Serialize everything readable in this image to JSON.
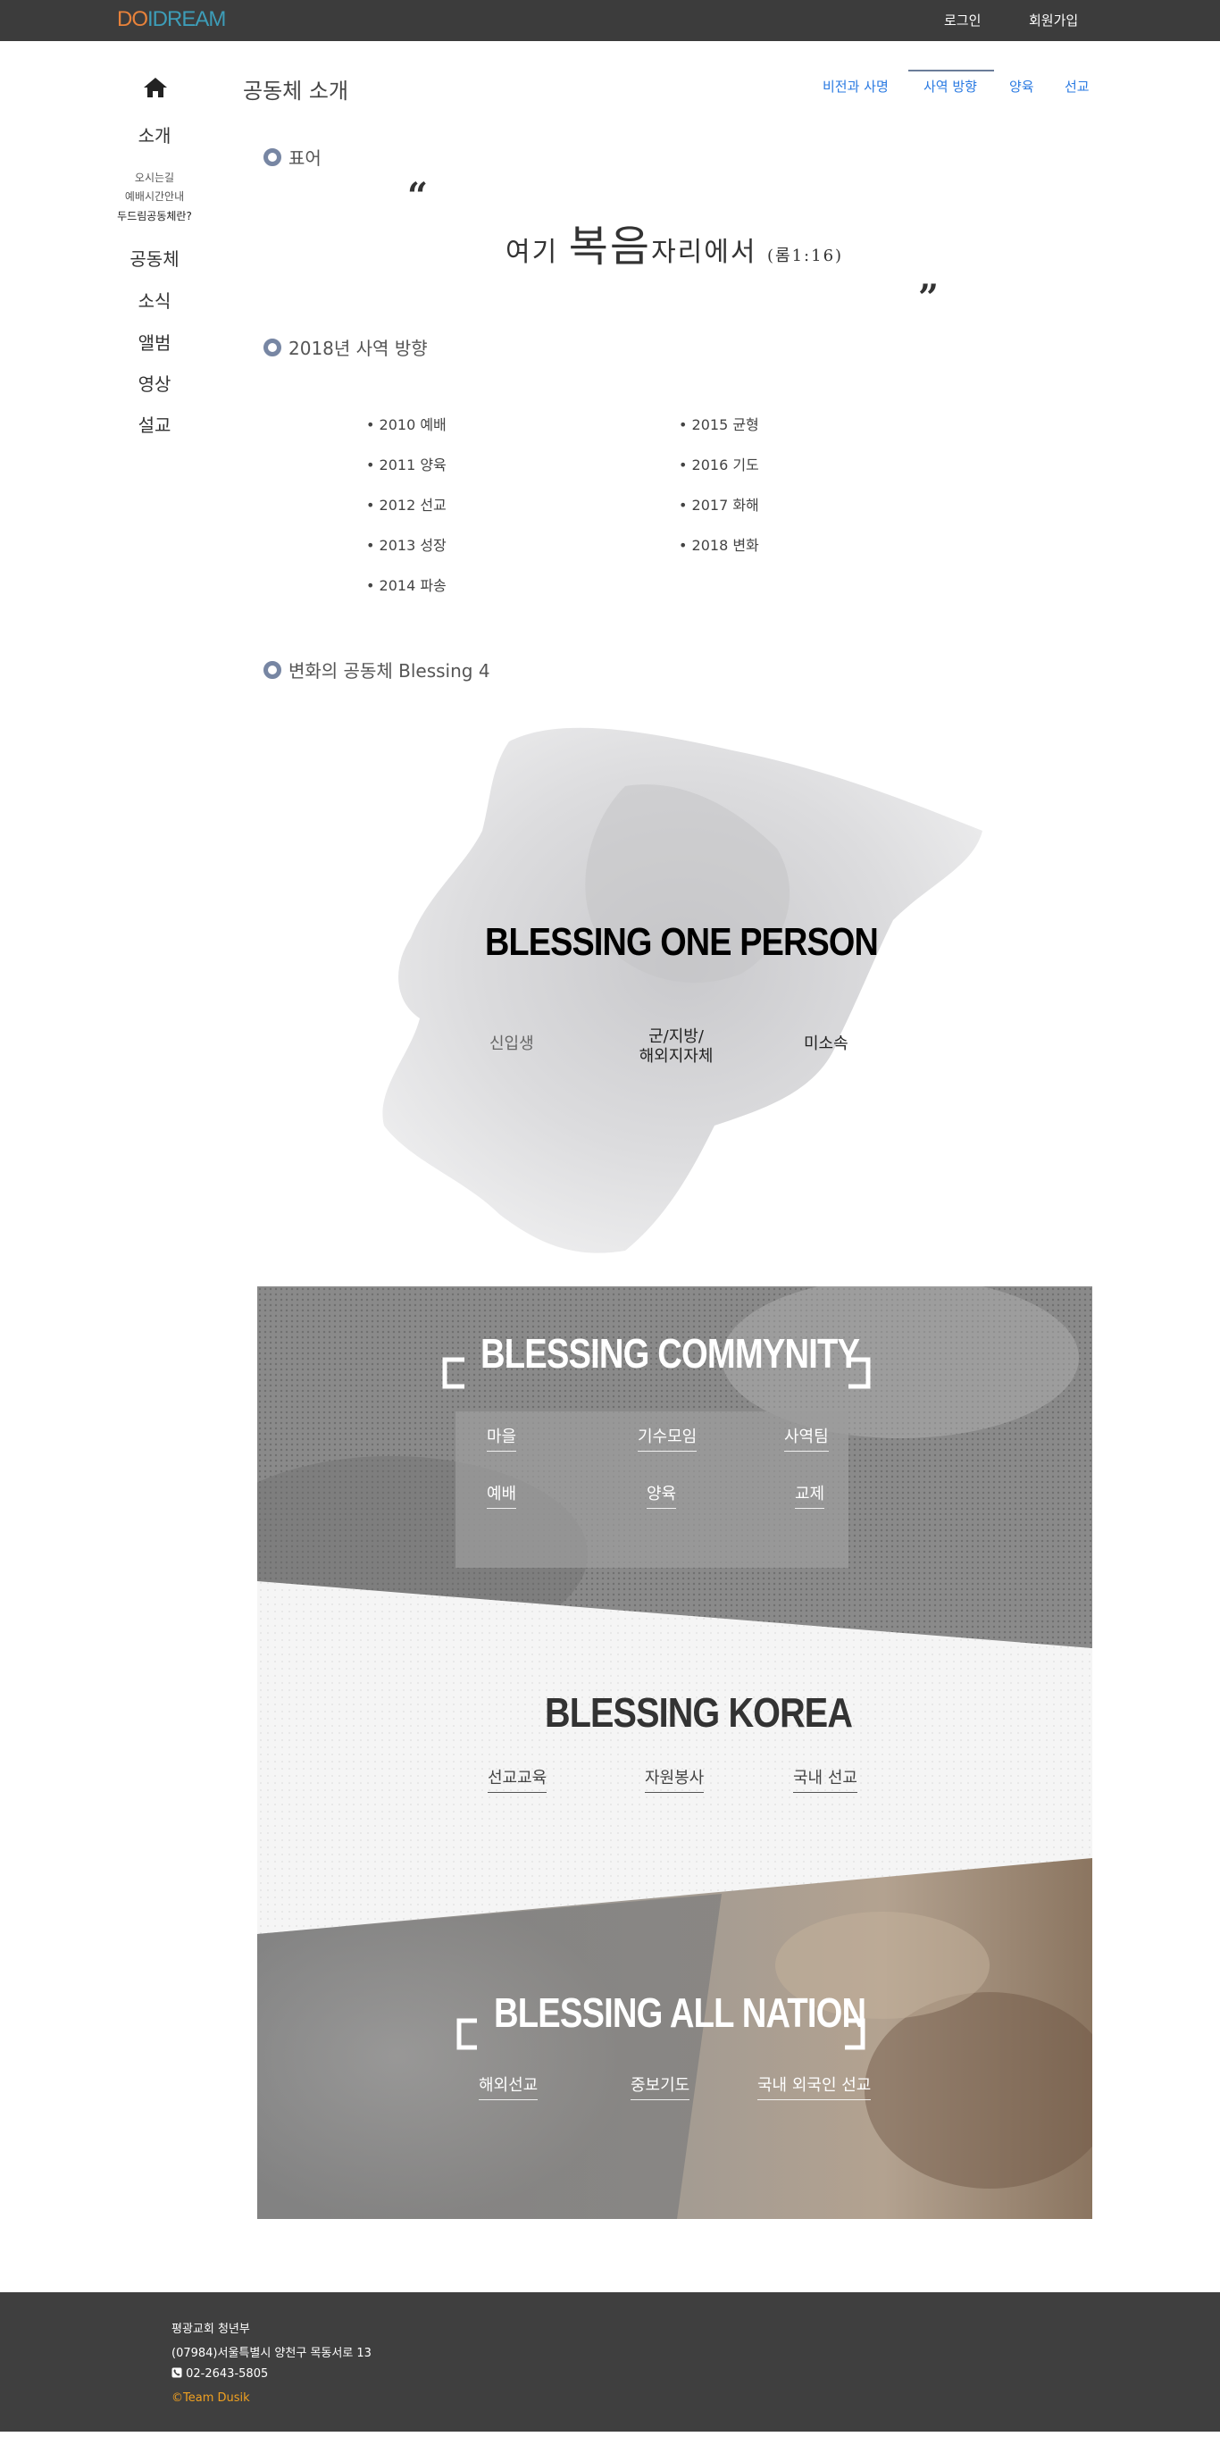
{
  "header": {
    "logo": {
      "part1": "DO",
      "part2": "I",
      "part3": "DREAM"
    },
    "login": "로그인",
    "signup": "회원가입"
  },
  "sidebar": {
    "home_icon": "home-icon",
    "items": [
      {
        "label": "소개"
      },
      {
        "label": "오시는길"
      },
      {
        "label": "예배시간안내"
      },
      {
        "label": "두드림공동체란?"
      },
      {
        "label": "공동체"
      },
      {
        "label": "소식"
      },
      {
        "label": "앨범"
      },
      {
        "label": "영상"
      },
      {
        "label": "설교"
      }
    ]
  },
  "main": {
    "title": "공동체 소개",
    "tabs": [
      {
        "label": "비전과 사명"
      },
      {
        "label": "사역 방향"
      },
      {
        "label": "양육"
      },
      {
        "label": "선교"
      }
    ],
    "active_tab": "사역 방향",
    "sections": {
      "motto": {
        "heading": "표어",
        "open_quote": "“",
        "close_quote": "”",
        "text_a": "여기 ",
        "text_b": "복음",
        "text_c": "자리에서 ",
        "text_d": "(롬1:16)"
      },
      "direction": {
        "heading": "2018년 사역 방향",
        "years": [
          "• 2010 예배",
          "• 2011 양육",
          "• 2012 선교",
          "• 2013 성장",
          "• 2014 파송",
          "• 2015 균형",
          "• 2016 기도",
          "• 2017 화해",
          "• 2018 변화"
        ]
      },
      "blessing": {
        "heading": "변화의 공동체 Blessing 4",
        "one_person": {
          "title": "BLESSING ONE PERSON",
          "items": [
            "신입생",
            "군/지방/",
            "해외지자체",
            "미소속"
          ]
        },
        "community": {
          "title": "BLESSING COMMYNITY",
          "items": [
            "마을",
            "기수모임",
            "사역팀",
            "예배",
            "양육",
            "교제"
          ]
        },
        "korea": {
          "title": "BLESSING KOREA",
          "items": [
            "선교교육",
            "자원봉사",
            "국내 선교"
          ]
        },
        "nation": {
          "title": "BLESSING ALL NATION",
          "items": [
            "해외선교",
            "중보기도",
            "국내 외국인 선교"
          ]
        }
      }
    }
  },
  "footer": {
    "org": "평광교회 청년부",
    "address": "(07984)서울특별시 양천구 목동서로 13",
    "phone": "02-2643-5805",
    "phone_icon": "phone-icon",
    "credit": "©Team Dusik"
  },
  "colors": {
    "topbar": "#3c3c3c",
    "tab_link": "#2a7ae2",
    "bullet_ring": "#7786a3",
    "footer_bg": "#3f3f3f",
    "credit": "#f0a020"
  }
}
